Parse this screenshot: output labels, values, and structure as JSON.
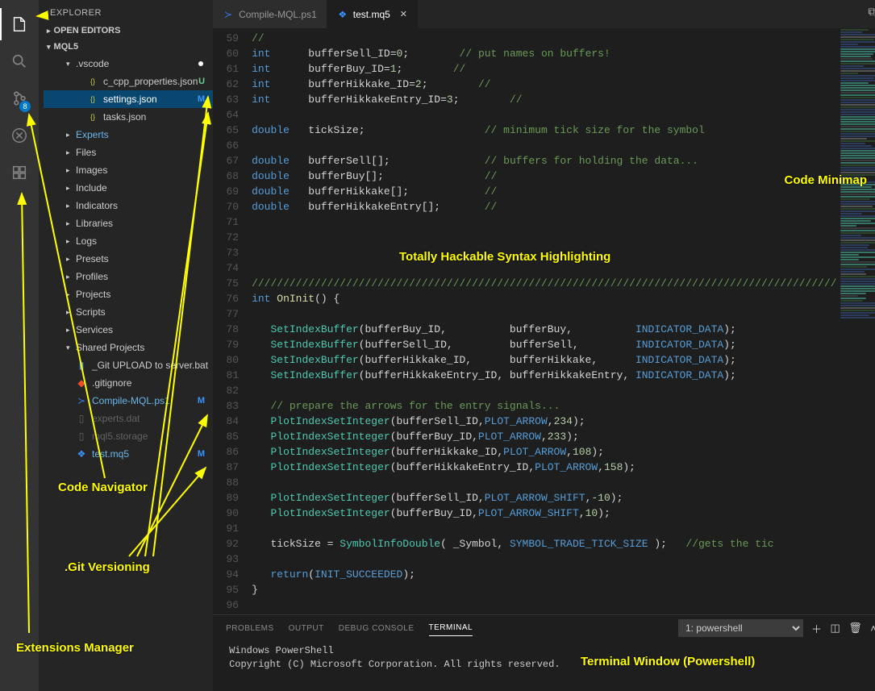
{
  "sidebar": {
    "title": "EXPLORER",
    "sections": [
      {
        "label": "OPEN EDITORS"
      },
      {
        "label": "MQL5"
      }
    ],
    "tree": {
      "vscode_folder": ".vscode",
      "files": {
        "c_cpp_props": "c_cpp_properties.json",
        "settings": "settings.json",
        "tasks": "tasks.json",
        "experts": "Experts",
        "files_dir": "Files",
        "images": "Images",
        "include": "Include",
        "indicators": "Indicators",
        "libraries": "Libraries",
        "logs": "Logs",
        "presets": "Presets",
        "profiles": "Profiles",
        "projects": "Projects",
        "scripts": "Scripts",
        "services": "Services",
        "shared": "Shared Projects",
        "git_upload": "_Git UPLOAD to server.bat",
        "gitignore": ".gitignore",
        "compile": "Compile-MQL.ps1",
        "experts_dat": "experts.dat",
        "mql5_storage": "mql5.storage",
        "test_mq5": "test.mq5"
      }
    },
    "git_badge": "8",
    "git_markers": {
      "U": "U",
      "M": "M"
    }
  },
  "tabs": [
    {
      "icon": "ps1",
      "label": "Compile-MQL.ps1"
    },
    {
      "icon": "mq5",
      "label": "test.mq5"
    }
  ],
  "code_lines": [
    {
      "n": 59,
      "type": "cm",
      "t": "//"
    },
    {
      "n": 60,
      "type": "decl",
      "kw": "int",
      "id": "bufferSell_ID",
      "eq": "=",
      "num": "0",
      "tail": ";",
      "cm": "// put names on buffers!"
    },
    {
      "n": 61,
      "type": "decl",
      "kw": "int",
      "id": "bufferBuy_ID",
      "eq": "=",
      "num": "1",
      "tail": ";",
      "cm": "//"
    },
    {
      "n": 62,
      "type": "decl",
      "kw": "int",
      "id": "bufferHikkake_ID",
      "eq": "=",
      "num": "2",
      "tail": ";",
      "cm": "//"
    },
    {
      "n": 63,
      "type": "decl",
      "kw": "int",
      "id": "bufferHikkakeEntry_ID",
      "eq": "=",
      "num": "3",
      "tail": ";",
      "cm": "//"
    },
    {
      "n": 64,
      "type": "blank"
    },
    {
      "n": 65,
      "type": "decl2",
      "kw": "double",
      "id": "tickSize",
      "tail": ";",
      "cm": "// minimum tick size for the symbol"
    },
    {
      "n": 66,
      "type": "blank"
    },
    {
      "n": 67,
      "type": "decl2",
      "kw": "double",
      "id": "bufferSell[]",
      "tail": ";",
      "cm": "// buffers for holding the data..."
    },
    {
      "n": 68,
      "type": "decl2",
      "kw": "double",
      "id": "bufferBuy[]",
      "tail": ";",
      "cm": "//"
    },
    {
      "n": 69,
      "type": "decl2",
      "kw": "double",
      "id": "bufferHikkake[]",
      "tail": ";",
      "cm": "//"
    },
    {
      "n": 70,
      "type": "decl2",
      "kw": "double",
      "id": "bufferHikkakeEntry[]",
      "tail": ";",
      "cm": "//"
    },
    {
      "n": 71,
      "type": "blank"
    },
    {
      "n": 72,
      "type": "blank"
    },
    {
      "n": 73,
      "type": "blank"
    },
    {
      "n": 74,
      "type": "blank"
    },
    {
      "n": 75,
      "type": "cm",
      "t": "/////////////////////////////////////////////////////////////////////////////////////////////"
    },
    {
      "n": 76,
      "type": "fnhead",
      "kw": "int",
      "fn": "OnInit",
      "tail": "() {"
    },
    {
      "n": 77,
      "type": "blank"
    },
    {
      "n": 78,
      "type": "call",
      "fn": "SetIndexBuffer",
      "args": "(bufferBuy_ID,          bufferBuy,          ",
      "const": "INDICATOR_DATA",
      "end": ");"
    },
    {
      "n": 79,
      "type": "call",
      "fn": "SetIndexBuffer",
      "args": "(bufferSell_ID,         bufferSell,         ",
      "const": "INDICATOR_DATA",
      "end": ");"
    },
    {
      "n": 80,
      "type": "call",
      "fn": "SetIndexBuffer",
      "args": "(bufferHikkake_ID,      bufferHikkake,      ",
      "const": "INDICATOR_DATA",
      "end": ");"
    },
    {
      "n": 81,
      "type": "call",
      "fn": "SetIndexBuffer",
      "args": "(bufferHikkakeEntry_ID, bufferHikkakeEntry, ",
      "const": "INDICATOR_DATA",
      "end": ");"
    },
    {
      "n": 82,
      "type": "blank"
    },
    {
      "n": 83,
      "type": "cm",
      "t": "   // prepare the arrows for the entry signals..."
    },
    {
      "n": 84,
      "type": "call2",
      "fn": "PlotIndexSetInteger",
      "args": "(bufferSell_ID,",
      "const": "PLOT_ARROW",
      "num": "234",
      "end": ");"
    },
    {
      "n": 85,
      "type": "call2",
      "fn": "PlotIndexSetInteger",
      "args": "(bufferBuy_ID,",
      "const": "PLOT_ARROW",
      "num": "233",
      "end": ");"
    },
    {
      "n": 86,
      "type": "call2",
      "fn": "PlotIndexSetInteger",
      "args": "(bufferHikkake_ID,",
      "const": "PLOT_ARROW",
      "num": "108",
      "end": ");"
    },
    {
      "n": 87,
      "type": "call2",
      "fn": "PlotIndexSetInteger",
      "args": "(bufferHikkakeEntry_ID,",
      "const": "PLOT_ARROW",
      "num": "158",
      "end": ");"
    },
    {
      "n": 88,
      "type": "blank"
    },
    {
      "n": 89,
      "type": "call2",
      "fn": "PlotIndexSetInteger",
      "args": "(bufferSell_ID,",
      "const": "PLOT_ARROW_SHIFT",
      "num": "-10",
      "end": ");"
    },
    {
      "n": 90,
      "type": "call2",
      "fn": "PlotIndexSetInteger",
      "args": "(bufferBuy_ID,",
      "const": "PLOT_ARROW_SHIFT",
      "num": "10",
      "end": ");"
    },
    {
      "n": 91,
      "type": "blank"
    },
    {
      "n": 92,
      "type": "assign",
      "id": "tickSize",
      "fn": "SymbolInfoDouble",
      "args": "( _Symbol, ",
      "const": "SYMBOL_TRADE_TICK_SIZE",
      "end": " );",
      "cm": "//gets the tic"
    },
    {
      "n": 93,
      "type": "blank"
    },
    {
      "n": 94,
      "type": "ret",
      "kw": "return",
      "const": "INIT_SUCCEEDED",
      "end": ");"
    },
    {
      "n": 95,
      "type": "raw",
      "t": "}"
    },
    {
      "n": 96,
      "type": "blank"
    }
  ],
  "panel": {
    "tabs": [
      "PROBLEMS",
      "OUTPUT",
      "DEBUG CONSOLE",
      "TERMINAL"
    ],
    "select": "1: powershell",
    "term_lines": [
      "Windows PowerShell",
      "Copyright (C) Microsoft Corporation. All rights reserved."
    ]
  },
  "annotations": {
    "a1": "Code Minimap",
    "a2": "Totally Hackable Syntax Highlighting",
    "a3": "Code Navigator",
    "a4": ".Git Versioning",
    "a5": "Extensions Manager",
    "a6": "Terminal Window (Powershell)"
  }
}
